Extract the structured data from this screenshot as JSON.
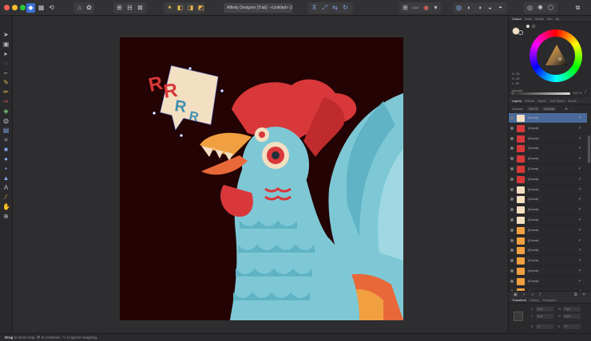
{
  "window": {
    "title": "Affinity Designer [Trial] - <Untitled> (13%)",
    "traffic_colors": [
      "#ff5f57",
      "#febc2e",
      "#28c840"
    ]
  },
  "toolbar": {
    "zoom_value": "1:10"
  },
  "artwork": {
    "speech_letters": [
      "R",
      "R",
      "R",
      "R"
    ],
    "colors": {
      "bg": "#230303",
      "red": "#d8383a",
      "blue": "#7ec8d6",
      "cream": "#f3dfc1",
      "orange": "#f0a040"
    }
  },
  "panels": {
    "top_tabs": [
      "Colour",
      "Swat",
      "Stroke",
      "Bru",
      "Ap"
    ],
    "colour": {
      "h": "H: 36",
      "s": "S: 43",
      "l": "L: 83",
      "opacity_label": "Opacity",
      "opacity_value": "100 %"
    },
    "layers_tabs": [
      "Layers",
      "Effects",
      "Styles",
      "Text Styles",
      "Brush"
    ],
    "layers_ctrl": {
      "opacity_label": "Opacity:",
      "opacity_value": "100 %",
      "blend": "Normal"
    },
    "layers": [
      {
        "name": "(Curve)",
        "selected": true,
        "thumb": "#f3dfc1"
      },
      {
        "name": "(Curve)",
        "thumb": "#d8383a"
      },
      {
        "name": "(Curve)",
        "thumb": "#d8383a"
      },
      {
        "name": "(Curve)",
        "thumb": "#d8383a"
      },
      {
        "name": "(Curve)",
        "thumb": "#d8383a"
      },
      {
        "name": "(Curve)",
        "thumb": "#d8383a"
      },
      {
        "name": "(Curve)",
        "thumb": "#d8383a"
      },
      {
        "name": "(Curve)",
        "thumb": "#f3dfc1"
      },
      {
        "name": "(Curve)",
        "thumb": "#f3dfc1"
      },
      {
        "name": "(Curve)",
        "thumb": "#f3dfc1"
      },
      {
        "name": "(Curve)",
        "thumb": "#f3dfc1"
      },
      {
        "name": "(Curve)",
        "thumb": "#f0a040"
      },
      {
        "name": "(Curve)",
        "thumb": "#f0a040"
      },
      {
        "name": "(Curve)",
        "thumb": "#f0a040"
      },
      {
        "name": "(Curve)",
        "thumb": "#f0a040"
      },
      {
        "name": "(Curve)",
        "thumb": "#f0a040"
      },
      {
        "name": "(Curve)",
        "thumb": "#f0a040"
      },
      {
        "name": "(Curve)",
        "thumb": "#f0a040"
      }
    ],
    "transform_tabs": [
      "Transform",
      "History",
      "Navigator"
    ],
    "transform": {
      "x": "0 px",
      "y": "0 px",
      "w": "0 px",
      "h": "0 px",
      "r": "0 °",
      "s": "0 °"
    }
  },
  "status": {
    "drag": "Drag",
    "text": " to move crop. ⌘ to constrain. ⌥ to ignore snapping."
  }
}
